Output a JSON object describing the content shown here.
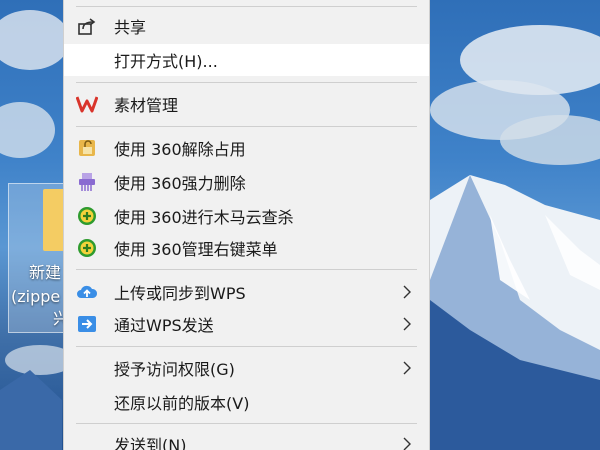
{
  "desktop": {
    "icon_label_line1": "新建",
    "icon_label_line2": "(zippe",
    "icon_label_line3": "兴"
  },
  "menu": {
    "items": [
      {
        "label": "共享",
        "icon": "share-icon"
      },
      {
        "label": "打开方式(H)..."
      },
      {
        "label": "素材管理",
        "icon": "wps-logo-icon",
        "color": "#d9342b"
      },
      {
        "label": "使用 360解除占用",
        "icon": "unlock-icon"
      },
      {
        "label": "使用 360强力删除",
        "icon": "shredder-icon"
      },
      {
        "label": "使用 360进行木马云查杀",
        "icon": "360-shield-icon"
      },
      {
        "label": "使用 360管理右键菜单",
        "icon": "360-shield-icon"
      },
      {
        "label": "上传或同步到WPS",
        "icon": "cloud-upload-icon",
        "submenu": true
      },
      {
        "label": "通过WPS发送",
        "icon": "send-arrow-icon",
        "submenu": true
      },
      {
        "label": "授予访问权限(G)",
        "submenu": true
      },
      {
        "label": "还原以前的版本(V)"
      },
      {
        "label": "发送到(N)",
        "submenu": true
      }
    ]
  }
}
